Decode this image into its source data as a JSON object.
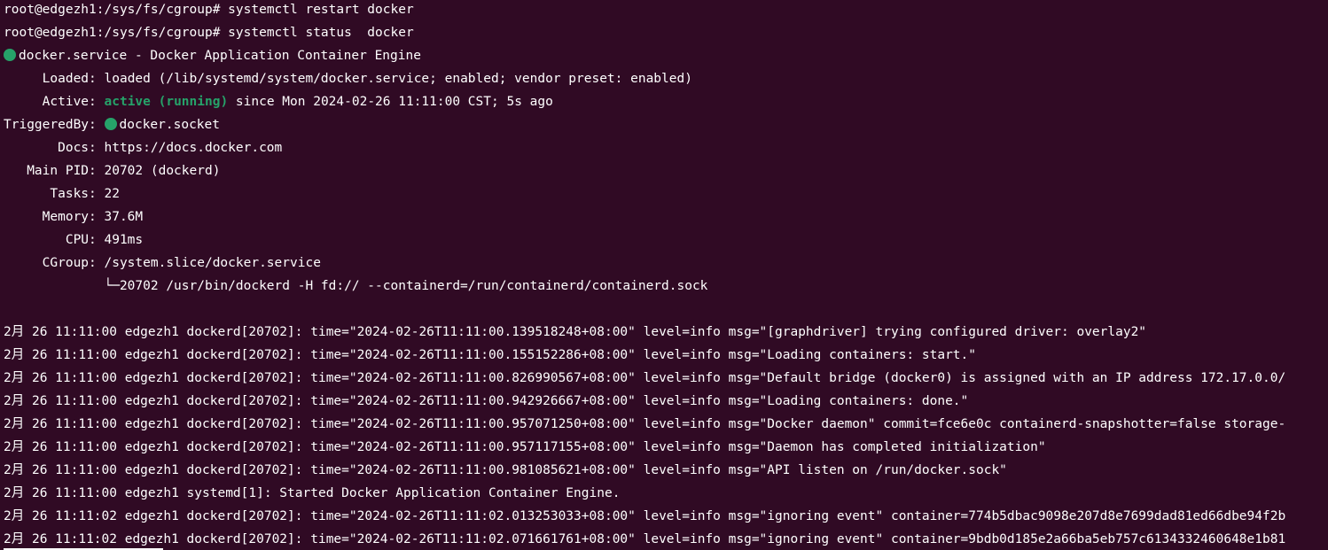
{
  "colors": {
    "background": "#300a24",
    "foreground": "#ffffff",
    "status_active": "#26a269"
  },
  "prompt": {
    "ps1": "root@edgezh1:/sys/fs/cgroup# ",
    "command1": "systemctl restart docker",
    "command2": "systemctl status  docker"
  },
  "status": {
    "service_line": "docker.service - Docker Application Container Engine",
    "loaded_key": "     Loaded: ",
    "loaded_value": "loaded (/lib/systemd/system/docker.service; enabled; vendor preset: enabled)",
    "active_key": "     Active: ",
    "active_state": "active (running)",
    "active_since": " since Mon 2024-02-26 11:11:00 CST; 5s ago",
    "triggered_key": "TriggeredBy: ",
    "triggered_value": "docker.socket",
    "docs": "       Docs: https://docs.docker.com",
    "main_pid": "   Main PID: 20702 (dockerd)",
    "tasks": "      Tasks: 22",
    "memory": "     Memory: 37.6M",
    "cpu": "        CPU: 491ms",
    "cgroup": "     CGroup: /system.slice/docker.service",
    "cgroup_child": "             └─20702 /usr/bin/dockerd -H fd:// --containerd=/run/containerd/containerd.sock"
  },
  "log_lines": [
    "2月 26 11:11:00 edgezh1 dockerd[20702]: time=\"2024-02-26T11:11:00.139518248+08:00\" level=info msg=\"[graphdriver] trying configured driver: overlay2\"",
    "2月 26 11:11:00 edgezh1 dockerd[20702]: time=\"2024-02-26T11:11:00.155152286+08:00\" level=info msg=\"Loading containers: start.\"",
    "2月 26 11:11:00 edgezh1 dockerd[20702]: time=\"2024-02-26T11:11:00.826990567+08:00\" level=info msg=\"Default bridge (docker0) is assigned with an IP address 172.17.0.0/",
    "2月 26 11:11:00 edgezh1 dockerd[20702]: time=\"2024-02-26T11:11:00.942926667+08:00\" level=info msg=\"Loading containers: done.\"",
    "2月 26 11:11:00 edgezh1 dockerd[20702]: time=\"2024-02-26T11:11:00.957071250+08:00\" level=info msg=\"Docker daemon\" commit=fce6e0c containerd-snapshotter=false storage-",
    "2月 26 11:11:00 edgezh1 dockerd[20702]: time=\"2024-02-26T11:11:00.957117155+08:00\" level=info msg=\"Daemon has completed initialization\"",
    "2月 26 11:11:00 edgezh1 dockerd[20702]: time=\"2024-02-26T11:11:00.981085621+08:00\" level=info msg=\"API listen on /run/docker.sock\"",
    "2月 26 11:11:00 edgezh1 systemd[1]: Started Docker Application Container Engine.",
    "2月 26 11:11:02 edgezh1 dockerd[20702]: time=\"2024-02-26T11:11:02.013253033+08:00\" level=info msg=\"ignoring event\" container=774b5dbac9098e207d8e7699dad81ed66dbe94f2b",
    "2月 26 11:11:02 edgezh1 dockerd[20702]: time=\"2024-02-26T11:11:02.071661761+08:00\" level=info msg=\"ignoring event\" container=9bdb0d185e2a66ba5eb757c6134332460648e1b81"
  ]
}
